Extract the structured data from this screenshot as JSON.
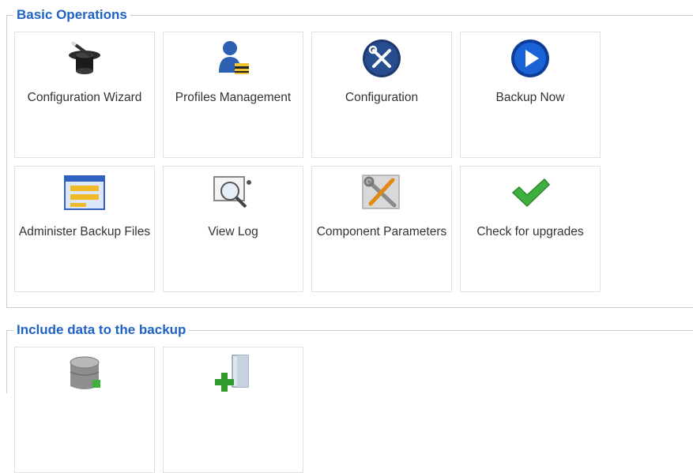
{
  "sections": [
    {
      "title": "Basic Operations",
      "tiles": [
        {
          "label": "Configuration Wizard",
          "icon": "magic-hat-icon"
        },
        {
          "label": "Profiles Management",
          "icon": "user-profile-icon"
        },
        {
          "label": "Configuration",
          "icon": "tools-icon"
        },
        {
          "label": "Backup Now",
          "icon": "play-icon"
        },
        {
          "label": "Administer Backup Files",
          "icon": "file-list-icon"
        },
        {
          "label": "View Log",
          "icon": "magnifier-log-icon"
        },
        {
          "label": "Component Parameters",
          "icon": "wrench-screwdriver-icon"
        },
        {
          "label": "Check for upgrades",
          "icon": "checkmark-icon"
        }
      ]
    },
    {
      "title": "Include data to the backup",
      "tiles": [
        {
          "label": "",
          "icon": "database-icon"
        },
        {
          "label": "",
          "icon": "add-files-icon"
        }
      ]
    }
  ],
  "colors": {
    "section_title": "#1f62c6",
    "tile_border": "#e1e1e1",
    "label": "#333333"
  }
}
